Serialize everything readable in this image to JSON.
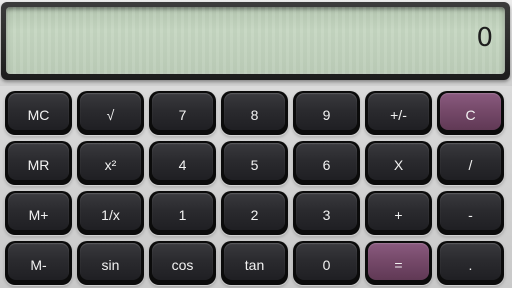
{
  "display": {
    "value": "0"
  },
  "keypad": {
    "accent_color": "#744868",
    "rows": [
      [
        {
          "name": "memory-clear-button",
          "label": "MC"
        },
        {
          "name": "square-root-button",
          "label": "√"
        },
        {
          "name": "digit-7-button",
          "label": "7"
        },
        {
          "name": "digit-8-button",
          "label": "8"
        },
        {
          "name": "digit-9-button",
          "label": "9"
        },
        {
          "name": "plus-minus-button",
          "label": "+/-"
        },
        {
          "name": "clear-button",
          "label": "C",
          "accent": true
        }
      ],
      [
        {
          "name": "memory-recall-button",
          "label": "MR"
        },
        {
          "name": "square-button",
          "label": "x²"
        },
        {
          "name": "digit-4-button",
          "label": "4"
        },
        {
          "name": "digit-5-button",
          "label": "5"
        },
        {
          "name": "digit-6-button",
          "label": "6"
        },
        {
          "name": "multiply-button",
          "label": "X"
        },
        {
          "name": "divide-button",
          "label": "/"
        }
      ],
      [
        {
          "name": "memory-add-button",
          "label": "M+"
        },
        {
          "name": "reciprocal-button",
          "label": "1/x"
        },
        {
          "name": "digit-1-button",
          "label": "1"
        },
        {
          "name": "digit-2-button",
          "label": "2"
        },
        {
          "name": "digit-3-button",
          "label": "3"
        },
        {
          "name": "add-button",
          "label": "+"
        },
        {
          "name": "subtract-button",
          "label": "-"
        }
      ],
      [
        {
          "name": "memory-subtract-button",
          "label": "M-"
        },
        {
          "name": "sine-button",
          "label": "sin"
        },
        {
          "name": "cosine-button",
          "label": "cos"
        },
        {
          "name": "tangent-button",
          "label": "tan"
        },
        {
          "name": "digit-0-button",
          "label": "0"
        },
        {
          "name": "equals-button",
          "label": "=",
          "accent": true
        },
        {
          "name": "decimal-point-button",
          "label": "."
        }
      ]
    ]
  }
}
